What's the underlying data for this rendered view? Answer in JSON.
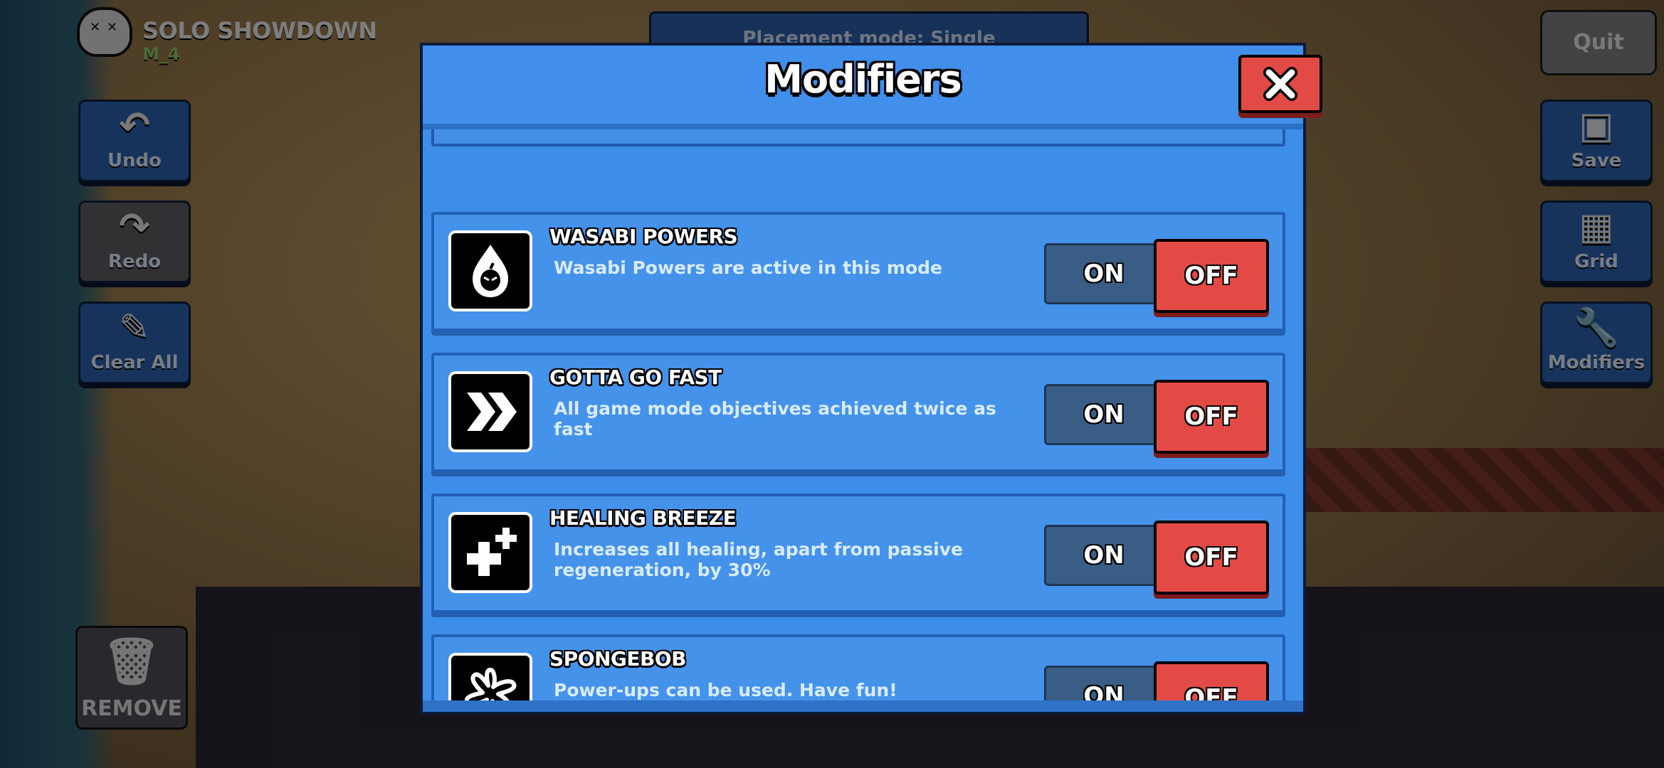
{
  "hud": {
    "mode_title": "SOLO SHOWDOWN",
    "map_name": "M_4",
    "placement_label": "Placement mode: Single",
    "quit_label": "Quit"
  },
  "left_tools": [
    {
      "label": "Undo",
      "icon": "undo-icon"
    },
    {
      "label": "Redo",
      "icon": "redo-icon"
    },
    {
      "label": "Clear All",
      "icon": "brush-icon"
    }
  ],
  "right_tools": [
    {
      "label": "Save",
      "icon": "save-icon"
    },
    {
      "label": "Grid",
      "icon": "grid-icon"
    },
    {
      "label": "Modifiers",
      "icon": "wrench-icon"
    }
  ],
  "remove_label": "REMOVE",
  "modal": {
    "title": "Modifiers",
    "close_icon": "close-icon",
    "modifiers": [
      {
        "name": "WASABI POWERS",
        "description": "Wasabi Powers are active in this mode",
        "icon": "wasabi-icon",
        "on_label": "ON",
        "off_label": "OFF",
        "state": "OFF"
      },
      {
        "name": "GOTTA GO FAST",
        "description": "All game mode objectives achieved twice as fast",
        "icon": "fast-forward-icon",
        "on_label": "ON",
        "off_label": "OFF",
        "state": "OFF"
      },
      {
        "name": "HEALING BREEZE",
        "description": "Increases all healing, apart from passive regeneration, by 30%",
        "icon": "heal-plus-icon",
        "on_label": "ON",
        "off_label": "OFF",
        "state": "OFF"
      },
      {
        "name": "SPONGEBOB",
        "description": "Power-ups can be used. Have fun!",
        "icon": "flower-icon",
        "on_label": "ON",
        "off_label": "OFF",
        "state": "OFF"
      }
    ]
  },
  "colors": {
    "modal_bg": "#3d8ee8",
    "off_active": "#e44a45",
    "on_inactive": "#3a5d86"
  }
}
